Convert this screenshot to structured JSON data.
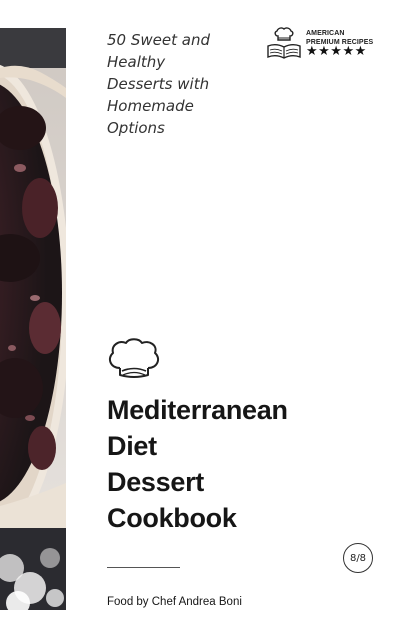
{
  "cover": {
    "tagline": [
      "50 Sweet and",
      "Healthy",
      "Desserts with",
      "Homemade",
      "Options"
    ],
    "brand": {
      "line1": "AMERICAN",
      "line2": "PREMIUM RECIPES",
      "stars": "★★★★★",
      "icon": "chef-book-icon"
    },
    "chef_hat_icon": "chef-hat-icon",
    "title_lines": [
      "Mediterranean",
      "Diet",
      "Dessert",
      "Cookbook"
    ],
    "volume_badge": "8/8",
    "author": "Food by Chef Andrea Boni",
    "photo": "dessert-tart-photo",
    "colors": {
      "text": "#161616",
      "photo_dark": "#2a2326",
      "plate": "#efe7dd"
    }
  }
}
